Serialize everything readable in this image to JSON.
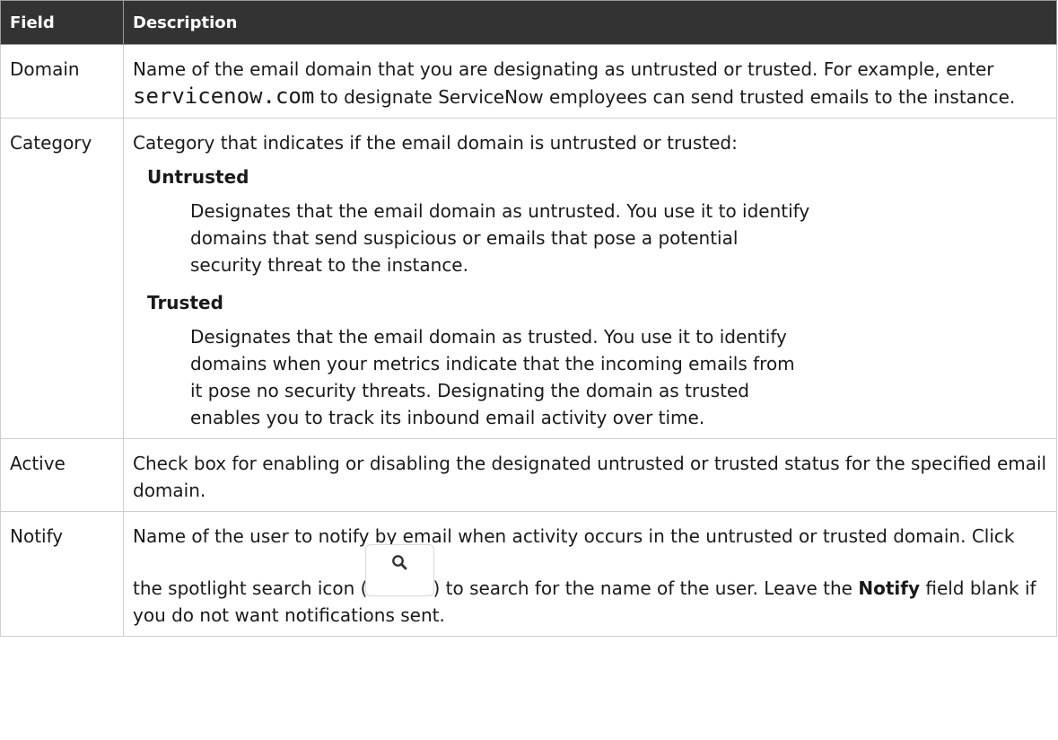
{
  "headers": {
    "field": "Field",
    "description": "Description"
  },
  "rows": {
    "domain": {
      "field": "Domain",
      "desc_a": "Name of the email domain that you are designating as untrusted or trusted. For example, enter ",
      "code": "servicenow.com",
      "desc_b": " to designate ServiceNow employees can send trusted emails to the instance."
    },
    "category": {
      "field": "Category",
      "intro": "Category that indicates if the email domain is untrusted or trusted:",
      "untrusted_term": "Untrusted",
      "untrusted_desc": "Designates that the email domain as untrusted. You use it to identify domains that send suspicious or emails that pose a potential security threat to the instance.",
      "trusted_term": "Trusted",
      "trusted_desc": "Designates that the email domain as trusted. You use it to identify domains when your metrics indicate that the incoming emails from it pose no security threats. Designating the domain as trusted enables you to track its inbound email activity over time."
    },
    "active": {
      "field": "Active",
      "desc": "Check box for enabling or disabling the designated untrusted or trusted status for the specified email domain."
    },
    "notify": {
      "field": "Notify",
      "desc_a": "Name of the user to notify by email when activity occurs in the untrusted or trusted domain. Click the spotlight search icon (",
      "icon": "search-icon",
      "desc_b": ") to search for the name of the user. Leave the ",
      "bold": "Notify",
      "desc_c": " field blank if you do not want notifications sent."
    }
  }
}
